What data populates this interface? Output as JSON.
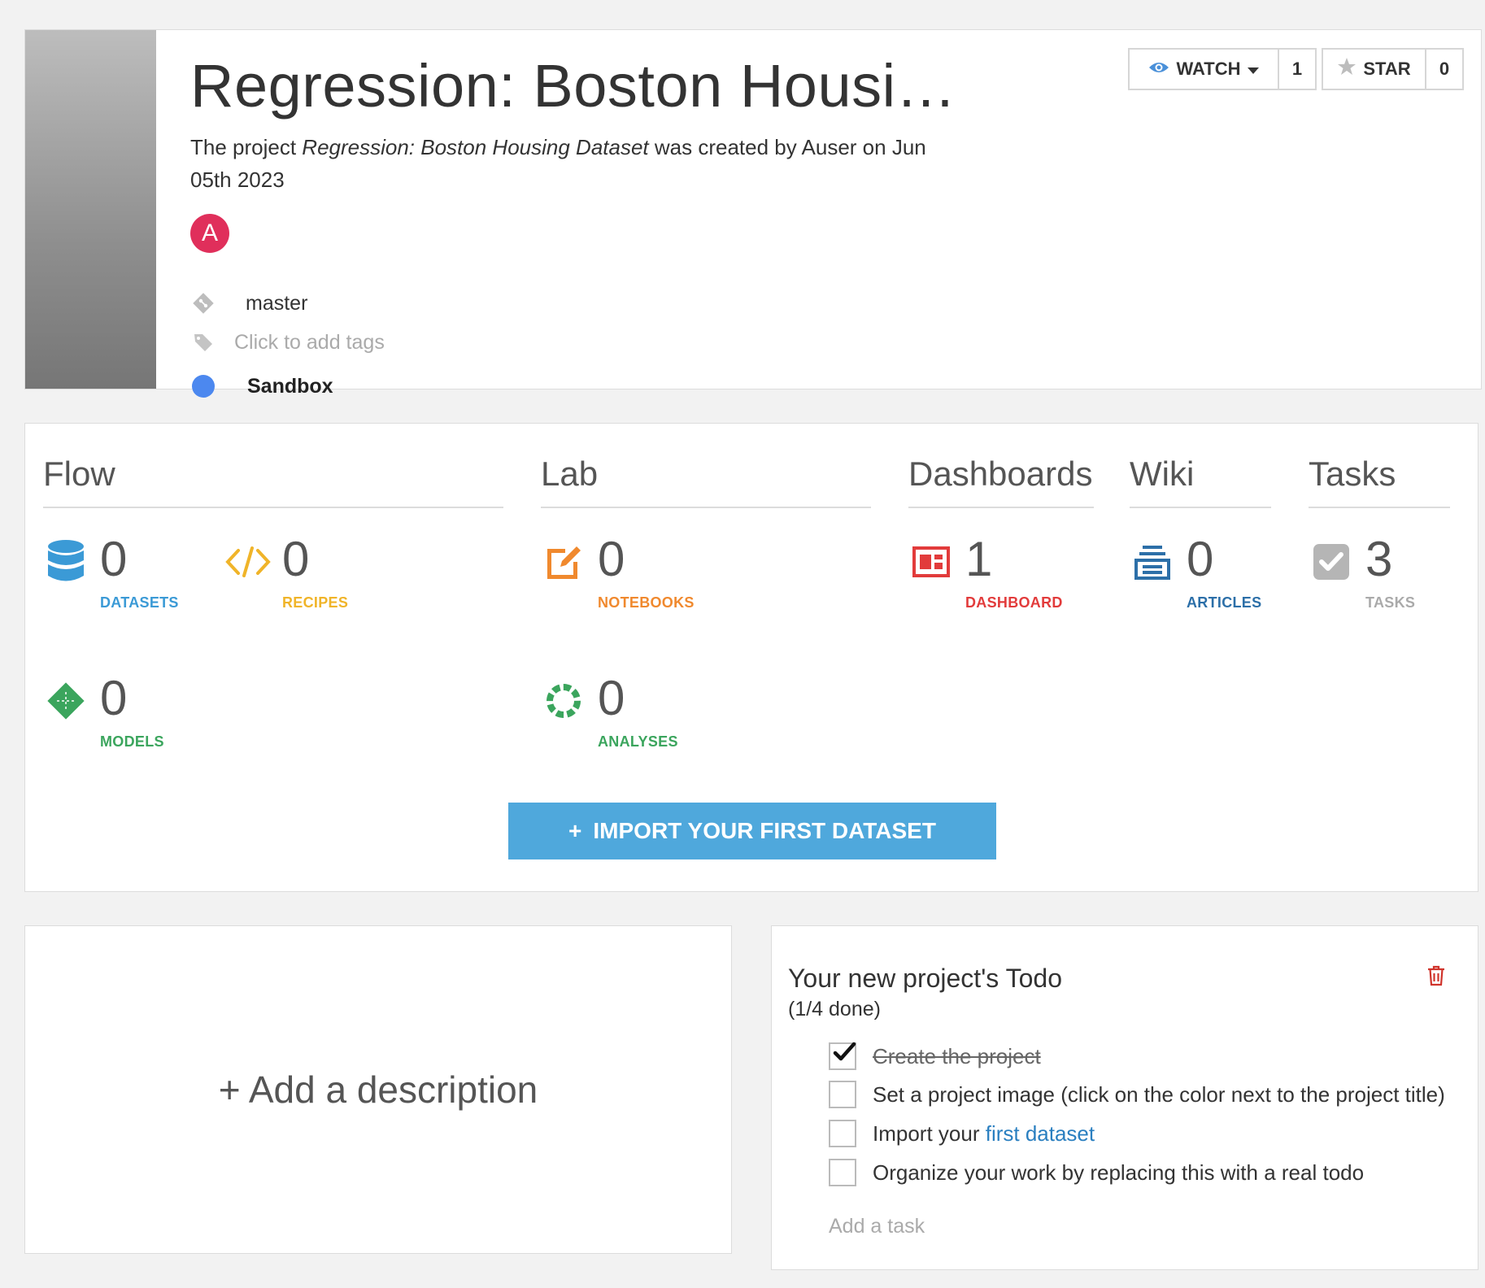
{
  "header": {
    "title": "Regression: Boston Housi…",
    "desc_prefix": "The project ",
    "desc_project": "Regression: Boston Housing Dataset",
    "desc_suffix": " was created by Auser on Jun 05th 2023",
    "avatar_initial": "A",
    "branch": "master",
    "tags_placeholder": "Click to add tags",
    "status": "Sandbox",
    "status_color": "#4c88ef",
    "watch_label": "WATCH",
    "watch_count": "1",
    "star_label": "STAR",
    "star_count": "0"
  },
  "summary": {
    "sections": {
      "flow": "Flow",
      "lab": "Lab",
      "dashboards": "Dashboards",
      "wiki": "Wiki",
      "tasks": "Tasks"
    },
    "stats": {
      "datasets": {
        "count": "0",
        "label": "DATASETS",
        "icon": "database-icon",
        "color": "#3b9ad6"
      },
      "recipes": {
        "count": "0",
        "label": "RECIPES",
        "icon": "code-icon",
        "color": "#f0b429"
      },
      "models": {
        "count": "0",
        "label": "MODELS",
        "icon": "model-icon",
        "color": "#3ba55d"
      },
      "notebooks": {
        "count": "0",
        "label": "NOTEBOOKS",
        "icon": "notebook-icon",
        "color": "#f0892e"
      },
      "analyses": {
        "count": "0",
        "label": "ANALYSES",
        "icon": "analysis-icon",
        "color": "#3ba55d"
      },
      "dashboard": {
        "count": "1",
        "label": "DASHBOARD",
        "icon": "dashboard-icon",
        "color": "#e23b3b"
      },
      "articles": {
        "count": "0",
        "label": "ARTICLES",
        "icon": "articles-icon",
        "color": "#2c6fa8"
      },
      "tasks": {
        "count": "3",
        "label": "TASKS",
        "icon": "tasks-icon",
        "color": "#aaaaaa"
      }
    },
    "import_button": "IMPORT YOUR FIRST DATASET",
    "import_plus": "+"
  },
  "description": {
    "add_label": "+ Add a description"
  },
  "todo": {
    "title": "Your new project's Todo",
    "progress": "(1/4 done)",
    "items": [
      {
        "text": "Create the project",
        "done": true
      },
      {
        "text": "Set a project image (click on the color next to the project title)",
        "done": false
      },
      {
        "text_prefix": "Import your ",
        "link": "first dataset",
        "done": false
      },
      {
        "text": "Organize your work by replacing this with a real todo",
        "done": false
      }
    ],
    "add_task_placeholder": "Add a task"
  }
}
